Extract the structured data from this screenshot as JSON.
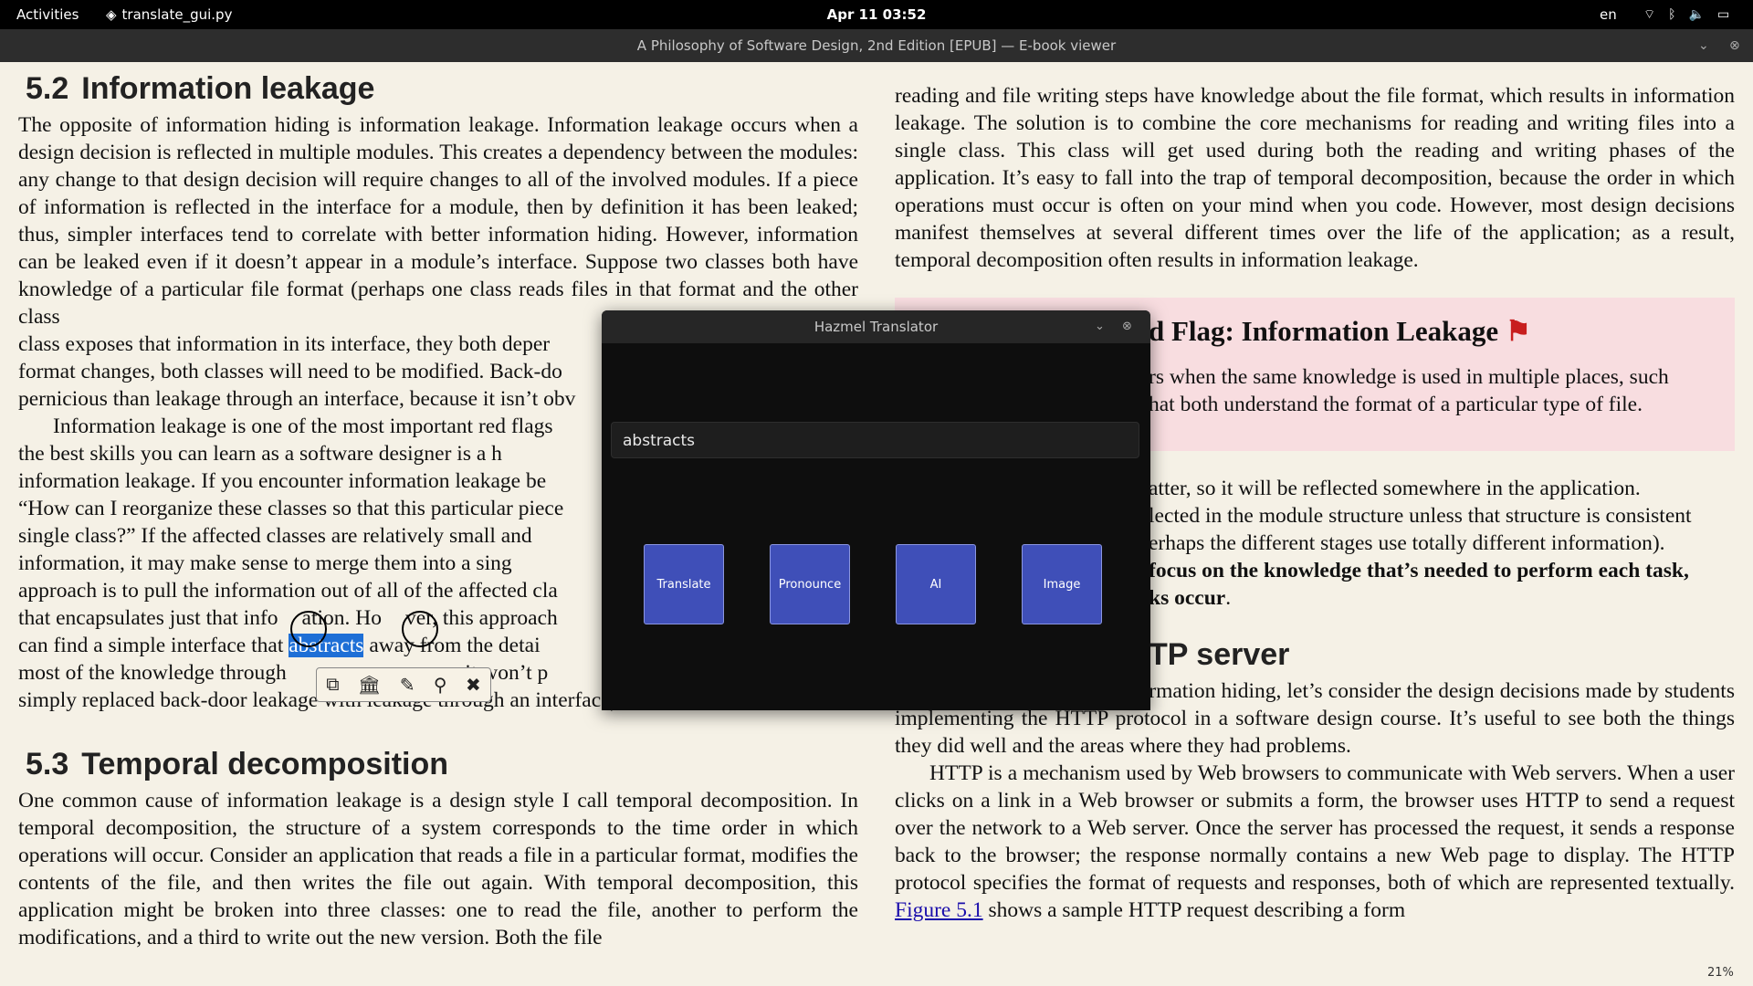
{
  "topbar": {
    "activities": "Activities",
    "app_name": "translate_gui.py",
    "clock": "Apr 11  03:52",
    "lang": "en"
  },
  "titlebar": {
    "title": "A Philosophy of Software Design, 2nd Edition [EPUB] — E-book viewer"
  },
  "left": {
    "h1_num": "5.2",
    "h1_title": "Information leakage",
    "p1": "The opposite of information hiding is information leakage. Information leakage occurs when a design decision is reflected in multiple modules. This creates a dependency between the modules: any change to that design decision will require changes to all of the involved modules. If a piece of information is reflected in the interface for a module, then by definition it has been leaked; thus, simpler interfaces tend to correlate with better information hiding. However, information can be leaked even if it doesn’t appear in a module’s interface. Suppose two classes both have knowledge of a particular file format (perhaps one class reads files in that format and the other class",
    "p1b": "class exposes that information in its interface, they both deper",
    "p1c": "format changes, both classes will need to be modified. Back-do",
    "p1d": "pernicious than leakage through an interface, because it isn’t obv",
    "p2a": "Information leakage is one of the most important red flags",
    "p2b": "the best skills you can learn as a software designer is a h",
    "p2c": "information leakage. If you encounter information leakage be",
    "p2d": "“How can I reorganize these classes so that this particular piece",
    "p2e": "single class?” If the affected classes are relatively small and",
    "p2f": "information, it may make sense to merge them into a sing",
    "p2g": "approach is to pull the information out of all of the affected cla",
    "p2h": "that encapsulates just that info",
    "p2h2": "ation. Ho",
    "p2h3": "ver, this approach",
    "p2i_pre": "can find a simple interface that ",
    "p2i_hl": "abstracts",
    "p2i_post": " away from the detai",
    "p2j_pre": "most of the knowledge through",
    "p2j_post": "n it won’t p",
    "p2k": "simply replaced back-door leakage with leakage through an interface).",
    "h2_num": "5.3",
    "h2_title": "Temporal decomposition",
    "p3": "One common cause of information leakage is a design style I call temporal decomposition. In temporal decomposition, the structure of a system corresponds to the time order in which operations will occur. Consider an application that reads a file in a particular format, modifies the contents of the file, and then writes the file out again. With temporal decomposition, this application might be broken into three classes: one to read the file, another to perform the modifications, and a third to write out the new version. Both the file"
  },
  "right": {
    "p1": "reading and file writing steps have knowledge about the file format, which results in information leakage. The solution is to combine the core mechanisms for reading and writing files into a single class. This class will get used during both the reading and writing phases of the application. It’s easy to fall into the trap of temporal decomposition, because the order in which operations must occur is often on your mind when you code. However, most design decisions manifest themselves at several different times over the life of the application; as a result, temporal decomposition often results in information leakage.",
    "rb_title": "d Flag: Information Leakage",
    "rb_l1": "rs when the same knowledge is used in multiple places, such",
    "rb_l2": "hat both understand the format of a particular type of file.",
    "p2a": "atter, so it will be reflected somewhere in the application.",
    "p2b": "lected in the module structure unless that structure is consistent",
    "p2c": "erhaps the different stages use totally different information).",
    "p2d": "focus on the knowledge that’s needed to perform each task,",
    "p2e": "ks occur",
    "h_title": "TP server",
    "p3": "To illustrate the issues in information hiding, let’s consider the design decisions made by students implementing the HTTP protocol in a software design course. It’s useful to see both the things they did well and the areas where they had problems.",
    "p4": "HTTP is a mechanism used by Web browsers to communicate with Web servers. When a user clicks on a link in a Web browser or submits a form, the browser uses HTTP to send a request over the network to a Web server. Once the server has processed the request, it sends a response back to the browser; the response normally contains a new Web page to display. The HTTP protocol specifies the format of requests and responses, both of which are represented textually.",
    "link": "Figure 5.1",
    "p4_tail": " shows a sample HTTP request describing a form"
  },
  "dialog": {
    "title": "Hazmel Translator",
    "input_value": "abstracts",
    "buttons": [
      "Translate",
      "Pronounce",
      "AI",
      "Image"
    ]
  },
  "zoom": "21%"
}
